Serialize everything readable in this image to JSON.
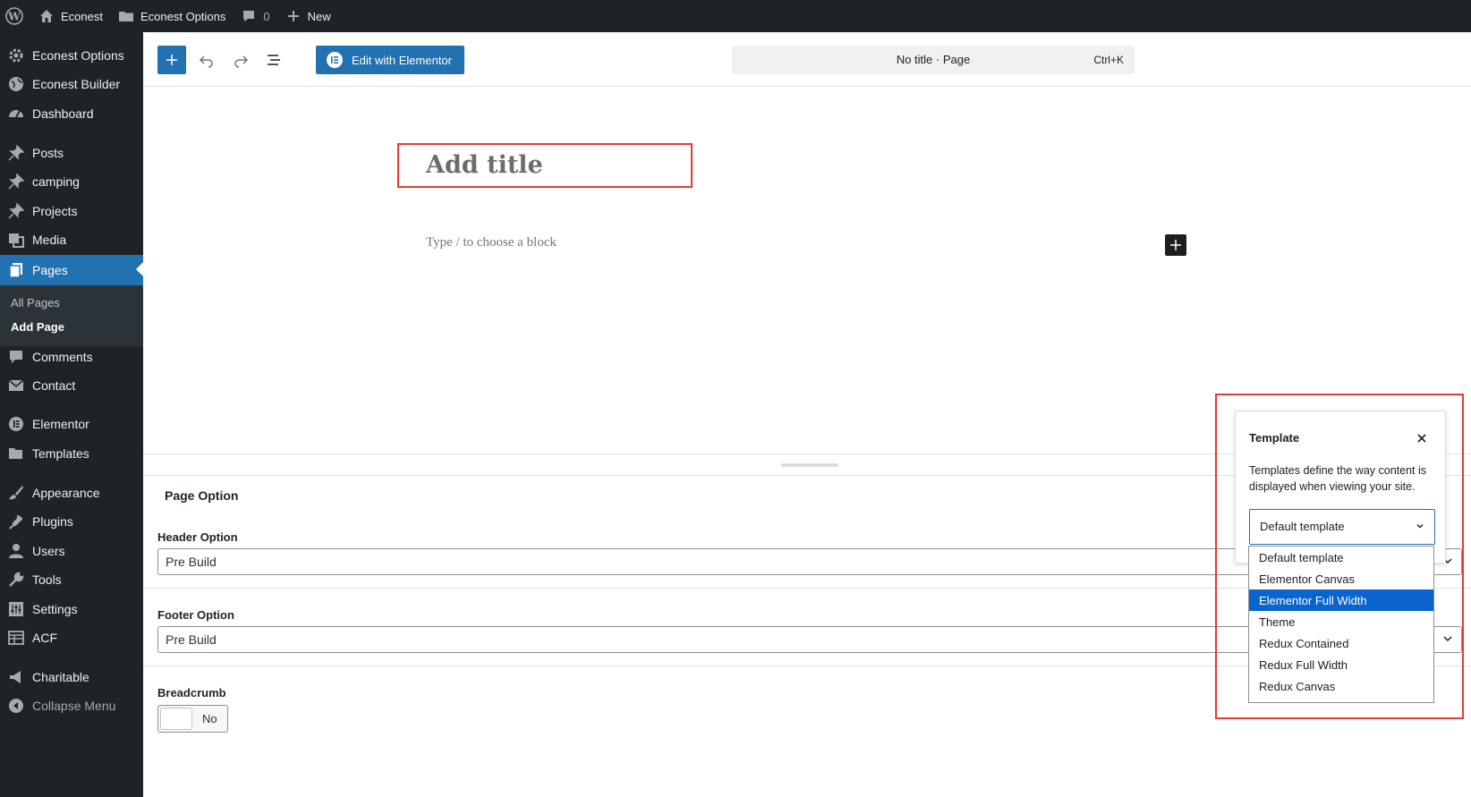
{
  "adminbar": {
    "site_name": "Econest",
    "options": "Econest Options",
    "comments_count": "0",
    "new_label": "New"
  },
  "sidebar": {
    "items": [
      {
        "label": "Econest Options",
        "icon": "gear-icon"
      },
      {
        "label": "Econest Builder",
        "icon": "globe-icon"
      },
      {
        "label": "Dashboard",
        "icon": "dashboard-icon"
      },
      {
        "label": "Posts",
        "icon": "pin-icon"
      },
      {
        "label": "camping",
        "icon": "pin-icon"
      },
      {
        "label": "Projects",
        "icon": "pin-icon"
      },
      {
        "label": "Media",
        "icon": "media-icon"
      },
      {
        "label": "Pages",
        "icon": "pages-icon"
      },
      {
        "label": "Comments",
        "icon": "comment-icon"
      },
      {
        "label": "Contact",
        "icon": "mail-icon"
      },
      {
        "label": "Elementor",
        "icon": "elementor-icon"
      },
      {
        "label": "Templates",
        "icon": "folder-icon"
      },
      {
        "label": "Appearance",
        "icon": "brush-icon"
      },
      {
        "label": "Plugins",
        "icon": "plugin-icon"
      },
      {
        "label": "Users",
        "icon": "user-icon"
      },
      {
        "label": "Tools",
        "icon": "wrench-icon"
      },
      {
        "label": "Settings",
        "icon": "settings-icon"
      },
      {
        "label": "ACF",
        "icon": "table-icon"
      },
      {
        "label": "Charitable",
        "icon": "megaphone-icon"
      },
      {
        "label": "Collapse Menu",
        "icon": "collapse-icon"
      }
    ],
    "submenu": {
      "all_pages": "All Pages",
      "add_page": "Add Page"
    }
  },
  "toolbar": {
    "elementor_label": "Edit with Elementor",
    "doc_title": "No title · Page",
    "shortcut": "Ctrl+K"
  },
  "editor": {
    "title_placeholder": "Add title",
    "block_placeholder": "Type / to choose a block"
  },
  "metabox": {
    "heading": "Page Option",
    "header_label": "Header Option",
    "header_value": "Pre Build",
    "footer_label": "Footer Option",
    "footer_value": "Pre Build",
    "breadcrumb_label": "Breadcrumb",
    "breadcrumb_value": "No"
  },
  "template_popover": {
    "title": "Template",
    "description": "Templates define the way content is displayed when viewing your site.",
    "selected": "Default template",
    "options": [
      "Default template",
      "Elementor Canvas",
      "Elementor Full Width",
      "Theme",
      "Redux Contained",
      "Redux Full Width",
      "Redux Canvas"
    ],
    "highlighted": "Elementor Full Width"
  },
  "colors": {
    "admin_dark": "#1d2327",
    "accent": "#2271b1",
    "highlight_border": "#e53b30",
    "option_highlight": "#0a64cb"
  }
}
